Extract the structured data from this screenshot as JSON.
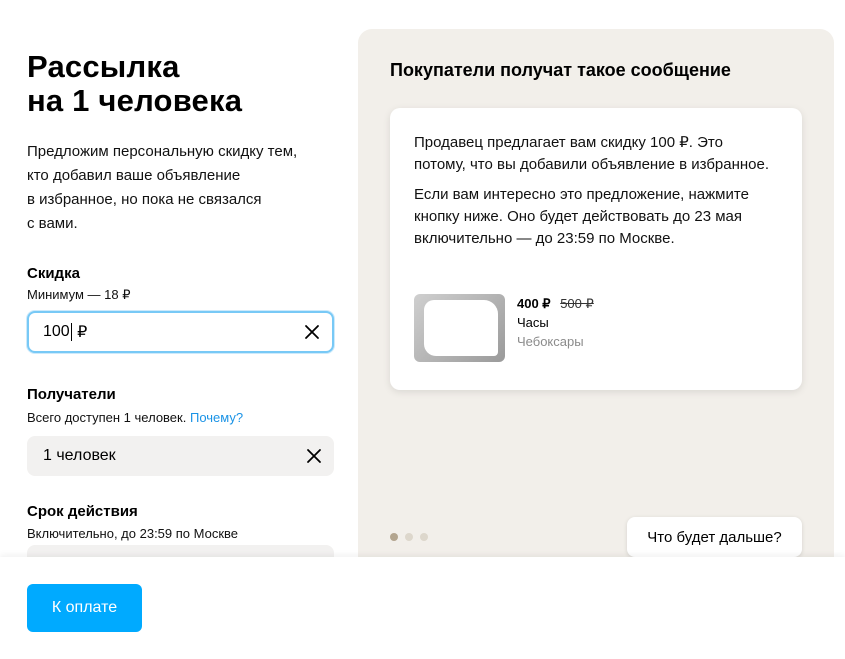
{
  "header": {
    "title_line1": "Рассылка",
    "title_line2": "на 1 человека",
    "description": [
      "Предложим персональную скидку тем,",
      "кто добавил ваше объявление",
      "в избранное, но пока не связался",
      "с вами."
    ]
  },
  "discount": {
    "label": "Скидка",
    "hint": "Минимум — 18 ₽",
    "value_before_caret": "100",
    "value_after_caret": " ₽"
  },
  "recipients": {
    "label": "Получатели",
    "hint": "Всего доступен 1 человек.",
    "hint_link": "Почему?",
    "value": "1 человек"
  },
  "validity": {
    "label": "Срок действия",
    "hint": "Включительно, до 23:59 по Москве"
  },
  "preview": {
    "title": "Покупатели получат такое сообщение",
    "message_p1": "Продавец предлагает вам скидку 100 ₽. Это потому, что вы добавили объявление в избранное.",
    "message_p2": "Если вам интересно это предложение, нажмите кнопку ниже. Оно будет действовать до 23 мая включительно — до 23:59 по Москве.",
    "product": {
      "price": "400 ₽",
      "old_price": "500 ₽",
      "name": "Часы",
      "city": "Чебоксары"
    },
    "next_button": "Что будет дальше?",
    "slides_total": 3,
    "slide_active": 1
  },
  "footer": {
    "pay_button": "К оплате"
  },
  "colors": {
    "accent": "#00aaff",
    "link": "#1a93e6",
    "panel_bg": "#f2efea",
    "field_bg": "#f2f1f0",
    "focus_border": "#78c9f6"
  }
}
